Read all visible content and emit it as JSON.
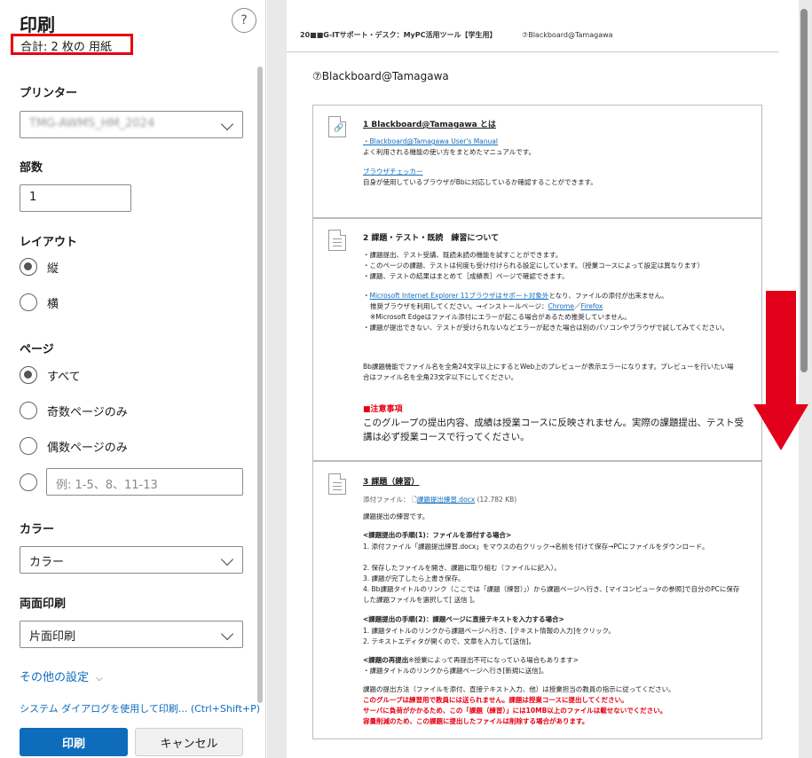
{
  "panel": {
    "title": "印刷",
    "help": "?",
    "total": "合計: 2 枚の 用紙",
    "printer_label": "プリンター",
    "printer_value": "TMG-AWMS_HM_2024",
    "copies_label": "部数",
    "copies_value": "1",
    "layout_label": "レイアウト",
    "layout_portrait": "縦",
    "layout_landscape": "横",
    "pages_label": "ページ",
    "pages_all": "すべて",
    "pages_odd": "奇数ページのみ",
    "pages_even": "偶数ページのみ",
    "pages_custom_placeholder": "例: 1-5、8、11-13",
    "color_label": "カラー",
    "color_value": "カラー",
    "duplex_label": "両面印刷",
    "duplex_value": "片面印刷",
    "more_settings": "その他の設定",
    "system_dialog": "システム ダイアログを使用して印刷... (Ctrl+Shift+P)",
    "print_button": "印刷",
    "cancel_button": "キャンセル"
  },
  "preview": {
    "header_left": "20■■G-ITサポート・デスク：MyPC活用ツール【学生用】",
    "header_right": "⑦Blackboard@Tamagawa",
    "page_title": "⑦Blackboard@Tamagawa",
    "s1": {
      "heading": "1 Blackboard@Tamagawa とは",
      "link1": "・Blackboard@Tamagawa User's Manual",
      "text1": "よく利用される機能の使い方をまとめたマニュアルです。",
      "link2": "ブラウザチェッカー",
      "text2": "自身が使用しているブラウザがBbに対応しているか確認することができます。"
    },
    "s2": {
      "heading": "2 課題・テスト・既読　練習について",
      "l1": "・課題提出、テスト受講、既読未読の機能を試すことができます。",
      "l2": "・このページの課題、テストは何度も受け付けられる設定にしています。（授業コースによって設定は異なります）",
      "l3": "・課題、テストの結果はまとめて［成績表］ページで確認できます。",
      "l4_link": "Microsoft Internet Explorer 11ブラウザはサポート対象外",
      "l4_text": "となり、ファイルの添付が出来ません。",
      "l5": "推奨ブラウザを利用してください。→インストールページ：",
      "l5_chrome": "Chrome",
      "l5_sep": "／",
      "l5_firefox": "Firefox",
      "l6": "※Microsoft Edgeはファイル添付にエラーが起こる場合があるため推奨していません。",
      "l7": "・課題が提出できない、テストが受けられないなどエラーが起きた場合は別のパソコンやブラウザで試してみてください。",
      "l8": "Bb課題機能でファイル名を全角24文字以上にするとWeb上のプレビューが表示エラーになります。プレビューを行いたい場合はファイル名を全角23文字以下にしてください。",
      "note_head": "■注意事項",
      "note_text": "このグループの提出内容、成績は授業コースに反映されません。実際の課題提出、テスト受講は必ず授業コースで行ってください。"
    },
    "s3": {
      "heading": "3 課題（練習）",
      "attach_label": "添付ファイル：",
      "attach_file": "課題提出練習.docx",
      "attach_size": "(12.782 KB)",
      "intro": "課題提出の練習です。",
      "h1": "<課題提出の手順(1)：ファイルを添付する場合>",
      "h1_1": "1. 添付ファイル「課題提出練習.docx」をマウスの右クリック→名前を付けて保存→PCにファイルをダウンロード。",
      "h1_2": "2. 保存したファイルを開き、課題に取り組む（ファイルに記入）。",
      "h1_3": "3. 課題が完了したら上書き保存。",
      "h1_4": "4. Bb課題タイトルのリンク（ここでは「課題（練習）」）から課題ページへ行き、[マイコンピュータの参照]で自分のPCに保存した課題ファイルを選択して[ 送信 ]。",
      "h2": "<課題提出の手順(2)：課題ページに直接テキストを入力する場合>",
      "h2_1": "1. 課題タイトルのリンクから課題ページへ行き、[テキスト情報の入力]をクリック。",
      "h2_2": "2. テキストエディタが開くので、文章を入力して[送信]。",
      "h3": "<課題の再提出",
      "h3_note": "※授業によって再提出不可になっている場合もあります>",
      "h3_1": "・課題タイトルのリンクから課題ページへ行き[新規に送信]。",
      "method": "課題の提出方法（ファイルを添付、直接テキスト入力、他）は授業担当の教員の指示に従ってください。",
      "red1": "このグループは練習用で教員には送られません。課題は授業コースに提出してください。",
      "red2": "サーバに負荷がかかるため、この「課題（練習）」には10MB以上のファイルは載せないでください。",
      "red3": "容量削減のため、この課題に提出したファイルは削除する場合があります。"
    }
  }
}
